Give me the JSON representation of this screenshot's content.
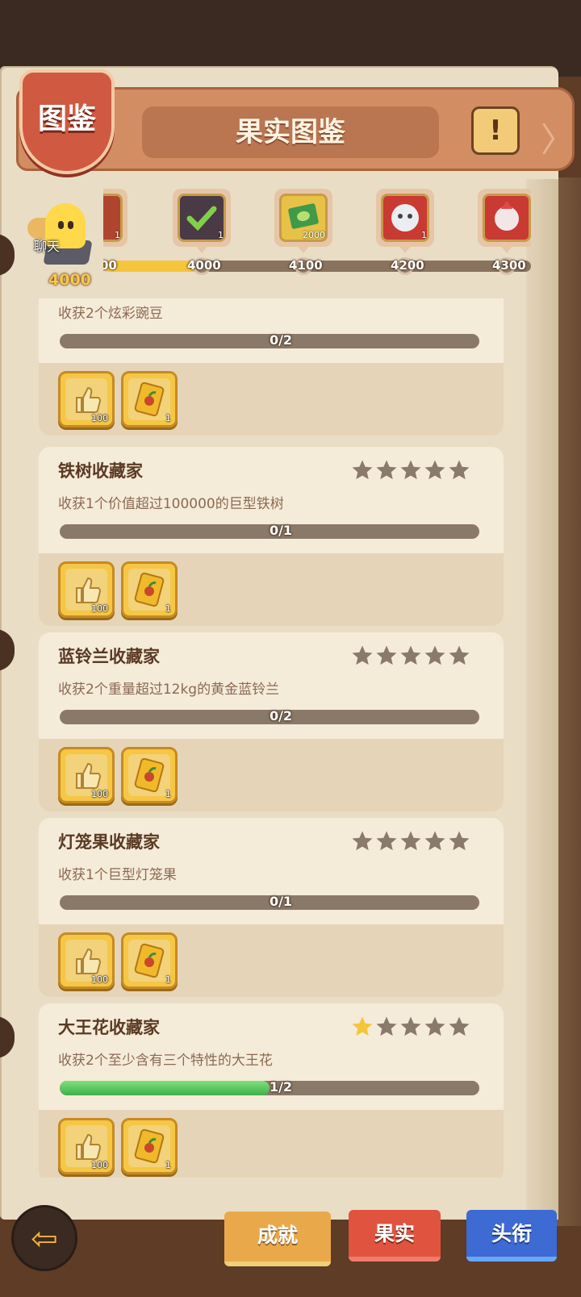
{
  "header": {
    "badge_label": "图鉴",
    "title": "果实图鉴",
    "info_icon": "!",
    "next_arrow": "〉"
  },
  "milestones": {
    "items": [
      {
        "count": "1",
        "color": "#b0452f",
        "icon": "card-icon"
      },
      {
        "count": "1",
        "color": "#4a3a46",
        "icon": "checkmark-icon"
      },
      {
        "count": "2000",
        "color": "#e8c247",
        "icon": "cash-icon"
      },
      {
        "count": "1",
        "color": "#c93a33",
        "icon": "monster-icon"
      },
      {
        "count": "",
        "color": "#c93a33",
        "icon": "creature-icon"
      }
    ],
    "labels": [
      "00",
      "4000",
      "4100",
      "4200",
      "4300"
    ],
    "progress_fraction": 0.23
  },
  "chat": {
    "label": "聊天",
    "score": "4000"
  },
  "achievements": [
    {
      "title": "",
      "desc": "收获2个炫彩豌豆",
      "progress": "0/2",
      "fraction": 0,
      "stars_filled": 0,
      "rewards": [
        "100",
        "1"
      ]
    },
    {
      "title": "铁树收藏家",
      "desc": "收获1个价值超过100000的巨型铁树",
      "progress": "0/1",
      "fraction": 0,
      "stars_filled": 0,
      "rewards": [
        "100",
        "1"
      ]
    },
    {
      "title": "蓝铃兰收藏家",
      "desc": "收获2个重量超过12kg的黄金蓝铃兰",
      "progress": "0/2",
      "fraction": 0,
      "stars_filled": 0,
      "rewards": [
        "100",
        "1"
      ]
    },
    {
      "title": "灯笼果收藏家",
      "desc": "收获1个巨型灯笼果",
      "progress": "0/1",
      "fraction": 0,
      "stars_filled": 0,
      "rewards": [
        "100",
        "1"
      ]
    },
    {
      "title": "大王花收藏家",
      "desc": "收获2个至少含有三个特性的大王花",
      "progress": "1/2",
      "fraction": 0.5,
      "stars_filled": 1,
      "rewards": [
        "100",
        "1"
      ]
    }
  ],
  "bottom": {
    "back_icon": "back-arrow-icon",
    "tabs": [
      "成就",
      "果实",
      "头衔"
    ]
  },
  "colors": {
    "star_filled": "#f5c63b",
    "star_empty": "#8a7a6c",
    "progress_fill": "#3fb04a"
  }
}
